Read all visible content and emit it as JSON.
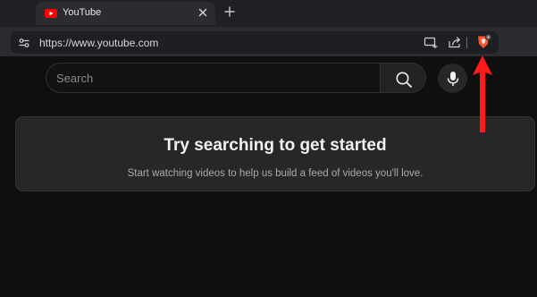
{
  "browser": {
    "tab": {
      "title": "YouTube"
    },
    "address_bar": {
      "url": "https://www.youtube.com"
    },
    "icons": {
      "favicon": "youtube-favicon",
      "close": "close-icon",
      "new_tab": "plus-icon",
      "site_info": "site-settings-icon",
      "cast": "cast-icon",
      "share": "share-icon",
      "shields": "brave-shields-icon"
    },
    "colors": {
      "accent_red": "#ff0000",
      "shields_orange": "#fb542b"
    }
  },
  "youtube": {
    "search": {
      "placeholder": "Search"
    },
    "empty_state": {
      "title": "Try searching to get started",
      "subtitle": "Start watching videos to help us build a feed of videos you'll love."
    }
  },
  "annotation": {
    "type": "arrow",
    "color": "#ff1a1a",
    "points_to": "brave-shields-icon"
  }
}
